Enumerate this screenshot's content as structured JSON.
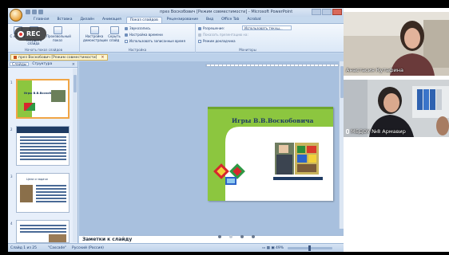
{
  "window": {
    "title": "през Воскобович [Режим совместимости] - Microsoft PowerPoint"
  },
  "ribbon": {
    "tabs": [
      "Главная",
      "Вставка",
      "Дизайн",
      "Анимация",
      "Показ слайдов",
      "Рецензирование",
      "Вид",
      "Office Tab",
      "Acrobat"
    ],
    "active_tab": "Показ слайдов",
    "group_start": {
      "from_start": "С начала",
      "from_current": "С текущего слайда",
      "custom_show": "Произвольный показ",
      "label": "Начать показ слайдов"
    },
    "group_setup": {
      "setup_show": "Настройка демонстрации",
      "hide_slide": "Скрыть слайд",
      "record_narration": "Звукозапись",
      "rehearse_timings": "Настройка времени",
      "use_timings": "Использовать записанные время",
      "label": "Настройка"
    },
    "group_monitors": {
      "resolution_label": "Разрешение:",
      "resolution_value": "Использовать текущ...",
      "show_on": "Показать презентацию на:",
      "presenter_view": "Режим докладчика",
      "label": "Мониторы"
    }
  },
  "document_tab": {
    "label": "през Воскобович [Режим совместимости]",
    "close": "×"
  },
  "left_pane": {
    "tabs": [
      "Слайды",
      "Структура"
    ],
    "close": "×",
    "thumbs": [
      {
        "num": "1",
        "title": "Игры В.В.Воскобовича"
      },
      {
        "num": "2",
        "title": ""
      },
      {
        "num": "3",
        "title": "Цели и задачи"
      },
      {
        "num": "4",
        "title": ""
      }
    ]
  },
  "slide": {
    "title": "Игры В.В.Воскобовича"
  },
  "notes": {
    "placeholder": "Заметки к слайду"
  },
  "statusbar": {
    "slide_counter": "Слайд 1 из 25",
    "theme": "\"Cascade\"",
    "language": "Русский (Россия)",
    "zoom": "49%"
  },
  "recording": {
    "label": "REC"
  },
  "participants": [
    {
      "name": "Анастасия Кутафина"
    },
    {
      "name": "МБДОУ №8 Армавир"
    }
  ],
  "colors": {
    "ribbon_blue": "#dbe8f7",
    "workspace": "#a8c0de",
    "slide_green": "#8cc63f",
    "slide_dark": "#1f3b63",
    "rec_red": "#e53935"
  }
}
